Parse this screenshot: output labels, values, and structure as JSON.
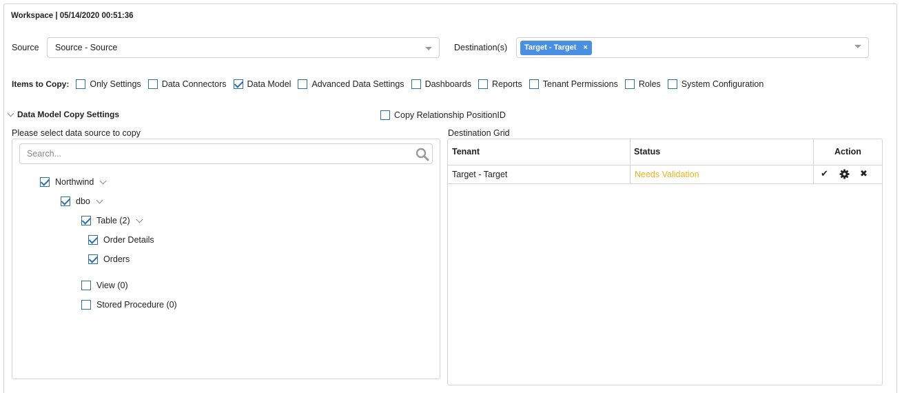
{
  "header": {
    "title": "Workspace | 05/14/2020 00:51:36"
  },
  "source": {
    "label": "Source",
    "value": "Source - Source"
  },
  "destination": {
    "label": "Destination(s)",
    "tags": [
      {
        "label": "Target - Target",
        "remove": "×"
      }
    ]
  },
  "items_to_copy": {
    "label": "Items to Copy:",
    "options": [
      {
        "label": "Only Settings",
        "checked": false
      },
      {
        "label": "Data Connectors",
        "checked": false
      },
      {
        "label": "Data Model",
        "checked": true
      },
      {
        "label": "Advanced Data Settings",
        "checked": false
      },
      {
        "label": "Dashboards",
        "checked": false
      },
      {
        "label": "Reports",
        "checked": false
      },
      {
        "label": "Tenant Permissions",
        "checked": false
      },
      {
        "label": "Roles",
        "checked": false
      },
      {
        "label": "System Configuration",
        "checked": false
      }
    ]
  },
  "data_model_settings": {
    "section_title": "Data Model Copy Settings",
    "copy_relationship_label": "Copy Relationship PositionID",
    "copy_relationship_checked": false,
    "select_source_label": "Please select data source to copy",
    "search_placeholder": "Search...",
    "tree": {
      "northwind": {
        "label": "Northwind",
        "checked": true
      },
      "dbo": {
        "label": "dbo",
        "checked": true
      },
      "table": {
        "label": "Table (2)",
        "checked": true
      },
      "order_details": {
        "label": "Order Details",
        "checked": true
      },
      "orders": {
        "label": "Orders",
        "checked": true
      },
      "view": {
        "label": "View (0)",
        "checked": false
      },
      "stored_procedure": {
        "label": "Stored Procedure (0)",
        "checked": false
      }
    }
  },
  "destination_grid": {
    "label": "Destination Grid",
    "columns": [
      "Tenant",
      "Status",
      "Action"
    ],
    "rows": [
      {
        "tenant": "Target - Target",
        "status": "Needs Validation",
        "status_color": "#f0b41e",
        "actions": [
          "check-icon",
          "gear-icon",
          "close-icon"
        ]
      }
    ]
  },
  "colors": {
    "accent": "#4a90e2",
    "checkbox": "#2a6db0",
    "warning": "#f0b41e"
  }
}
